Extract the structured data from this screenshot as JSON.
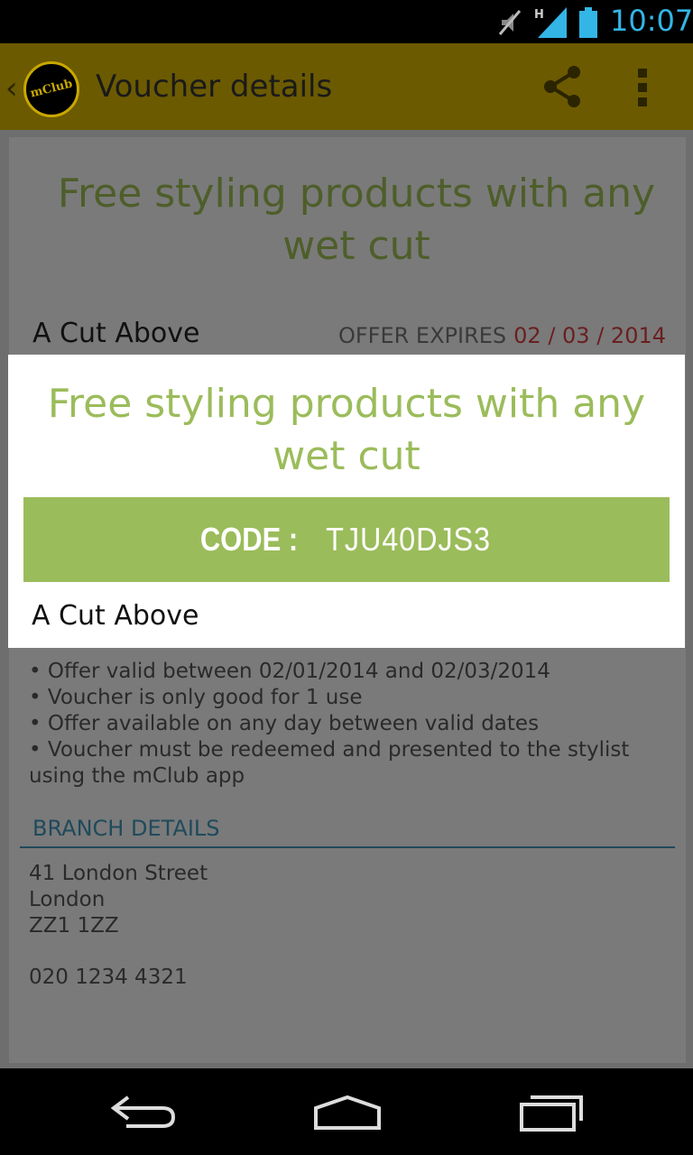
{
  "status_bar": {
    "time": "10:07",
    "network_type": "H",
    "icons": [
      "mute-icon",
      "signal-icon",
      "battery-icon"
    ]
  },
  "action_bar": {
    "logo_text": "mClub",
    "title": "Voucher details",
    "icons": [
      "back-chevron-icon",
      "share-icon",
      "overflow-menu-icon"
    ]
  },
  "voucher": {
    "title": "Free styling products with any wet cut",
    "merchant": "A Cut Above",
    "expires_label": "OFFER EXPIRES",
    "expires_date": "02 / 03 / 2014",
    "terms": [
      "• Offer valid between 02/01/2014 and 02/03/2014",
      "• Voucher is only good for 1 use",
      "• Offer available on any day between valid dates",
      "• Voucher must be redeemed and presented to the stylist using the mClub app"
    ]
  },
  "branch": {
    "header": "BRANCH DETAILS",
    "address_line1": "41 London Street",
    "address_line2": "London",
    "address_line3": "ZZ1 1ZZ",
    "phone": "020 1234 4321"
  },
  "dialog": {
    "title": "Free styling products with any wet cut",
    "code_label": "CODE :",
    "code_value": "TJU40DJS3",
    "merchant": "A Cut Above"
  },
  "colors": {
    "accent_green": "#9bbc5b",
    "action_bar": "#6b5a00",
    "clock_blue": "#33b5e5",
    "branch_blue": "#1f4a5c",
    "expiry_red": "#6a1f1f"
  },
  "nav_bar": {
    "icons": [
      "back-icon",
      "home-icon",
      "recents-icon"
    ]
  }
}
